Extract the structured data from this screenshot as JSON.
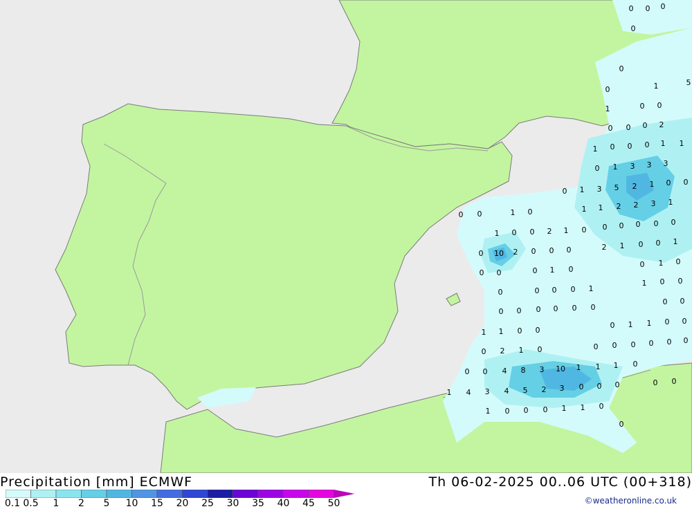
{
  "title": "Precipitation [mm] ECMWF",
  "valid_time": "Th 06-02-2025 00..06 UTC (00+318)",
  "credit": "©weatheronline.co.uk",
  "colors": {
    "sea": "#ebebeb",
    "land": "#c3f5a0",
    "border": "#999999",
    "coast": "#7a7a7a"
  },
  "legend": {
    "labels": [
      "0.1",
      "0.5",
      "1",
      "2",
      "5",
      "10",
      "15",
      "20",
      "25",
      "30",
      "35",
      "40",
      "45",
      "50"
    ],
    "colors": [
      "#d4fbfb",
      "#aff1f3",
      "#8ae4ee",
      "#65cfe6",
      "#50b7e2",
      "#4f95e4",
      "#436ce0",
      "#3046d4",
      "#1c1ca4",
      "#6b06d6",
      "#9d06e4",
      "#c806ea",
      "#e606e0",
      "#bb08b8"
    ]
  },
  "map_values": [
    "0",
    "0",
    "0",
    "0",
    "5",
    "0",
    "0",
    "1",
    "1",
    "0",
    "0",
    "0",
    "0",
    "0",
    "2",
    "1",
    "0",
    "0",
    "0",
    "1",
    "1",
    "0",
    "1",
    "3",
    "3",
    "3",
    "0",
    "1",
    "3",
    "5",
    "2",
    "1",
    "0",
    "0",
    "1",
    "1",
    "2",
    "2",
    "3",
    "1",
    "0",
    "0",
    "1",
    "0",
    "0",
    "0",
    "0",
    "0",
    "0",
    "1",
    "0",
    "0",
    "2",
    "1",
    "0",
    "2",
    "1",
    "0",
    "0",
    "1",
    "0",
    "10",
    "2",
    "0",
    "0",
    "0",
    "0",
    "1",
    "0",
    "0",
    "0",
    "0",
    "1",
    "0",
    "1",
    "0",
    "0",
    "0",
    "0",
    "0",
    "0",
    "1",
    "0",
    "0",
    "0",
    "0",
    "0",
    "0",
    "0",
    "0",
    "0",
    "1",
    "1",
    "0",
    "0",
    "1",
    "1",
    "0",
    "0",
    "0",
    "0",
    "0",
    "0",
    "0",
    "0",
    "0",
    "2",
    "1",
    "0",
    "0",
    "0",
    "4",
    "8",
    "3",
    "10",
    "1",
    "1",
    "1",
    "0",
    "0",
    "0",
    "1",
    "4",
    "3",
    "4",
    "5",
    "2",
    "3",
    "0",
    "0",
    "0",
    "1",
    "0",
    "0",
    "0",
    "1",
    "1",
    "0",
    "0"
  ]
}
